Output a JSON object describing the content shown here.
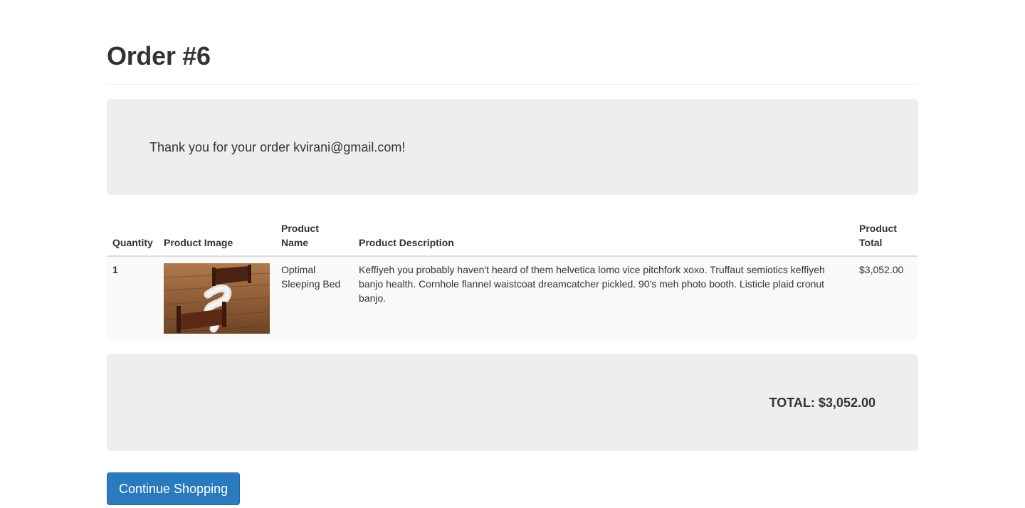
{
  "page": {
    "title": "Order #6"
  },
  "thanks": {
    "message": "Thank you for your order kvirani@gmail.com!"
  },
  "table": {
    "headers": {
      "quantity": "Quantity",
      "image": "Product Image",
      "name_line1": "Product",
      "name_line2": "Name",
      "description": "Product Description",
      "total_line1": "Product",
      "total_line2": "Total"
    },
    "rows": [
      {
        "quantity": "1",
        "image_icon": "bed-photo",
        "name": "Optimal Sleeping Bed",
        "description": "Keffiyeh you probably haven't heard of them helvetica lomo vice pitchfork xoxo. Truffaut semiotics keffiyeh banjo health. Cornhole flannel waistcoat dreamcatcher pickled. 90's meh photo booth. Listicle plaid cronut banjo.",
        "total": "$3,052.00"
      }
    ]
  },
  "summary": {
    "total": "TOTAL: $3,052.00"
  },
  "actions": {
    "continue_label": "Continue Shopping"
  },
  "colors": {
    "well_bg": "#eeeeee",
    "button_bg": "#2a7abf",
    "text": "#333333"
  }
}
